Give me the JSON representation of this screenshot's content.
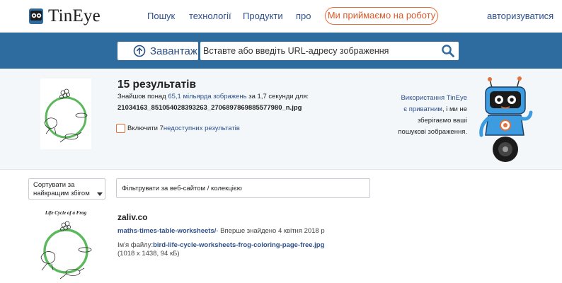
{
  "nav": {
    "logo_text": "TinEye",
    "items": [
      "Пошук",
      "технології",
      "Продукти",
      "про"
    ],
    "hire_label": "Ми приймаємо на роботу",
    "login_label": "авторизуватися"
  },
  "search": {
    "upload_label": "Завантажи",
    "url_placeholder": "Вставте або введіть URL-адресу зображення"
  },
  "summary": {
    "results_title": "15 результатів",
    "found_prefix": "Знайшов понад ",
    "found_count": "65,1 мільярда зображень",
    "found_suffix": " за 1,7 секунди для:",
    "filename": "21034163_851054028393263_2706897869885577980_n.jpg",
    "unavailable_prefix": "Включити 7 ",
    "unavailable_link": "недоступних результатів",
    "privacy_prefix": "Використання TinEye є ",
    "privacy_link": "приватним",
    "privacy_suffix": ", і ми не зберігаємо ваші пошукові зображення."
  },
  "filters": {
    "sort_label": "Сортувати за найкращим збігом",
    "filter_placeholder": "Фільтрувати за веб-сайтом / колекцією"
  },
  "results": [
    {
      "domain": "zaliv.co",
      "page_link": "maths-times-table-worksheets/",
      "first_seen": "- Вперше знайдено 4 квітня 2018 р",
      "file_label": "Ім'я файлу:",
      "file_link": "bird-life-cycle-worksheets-frog-coloring-page-free.jpg",
      "dimensions": "(1018 x 1438, 94 кБ)",
      "thumb_title": "Life Cycle of a Frog"
    }
  ],
  "colors": {
    "nav_link": "#2d4f8c",
    "accent_orange": "#e4703a",
    "search_band": "#2e6ca0",
    "summary_bg": "#f4f7fa",
    "robot_blue": "#3d9be0"
  }
}
